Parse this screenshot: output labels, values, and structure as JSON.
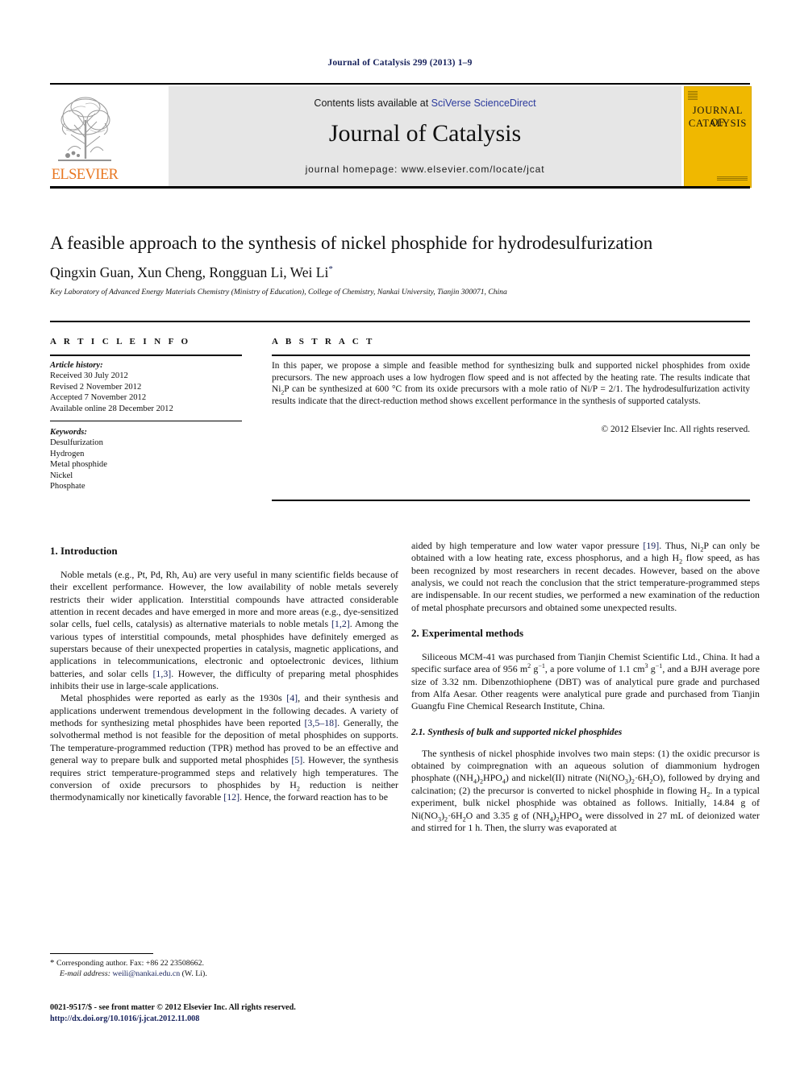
{
  "running_head": "Journal of Catalysis 299 (2013) 1–9",
  "masthead": {
    "contents_prefix": "Contents lists available at ",
    "contents_link": "SciVerse ScienceDirect",
    "journal_title": "Journal of Catalysis",
    "homepage": "journal homepage: www.elsevier.com/locate/jcat",
    "publisher": "ELSEVIER",
    "cover_line1": "JOURNAL OF",
    "cover_line2": "CATALYSIS",
    "cover_color": "#f0b800",
    "publisher_color": "#e87722",
    "link_color": "#2b3a9c"
  },
  "article": {
    "title": "A feasible approach to the synthesis of nickel phosphide for hydrodesulfurization",
    "authors": "Qingxin Guan, Xun Cheng, Rongguan Li, Wei Li",
    "author_marker": "*",
    "affiliation": "Key Laboratory of Advanced Energy Materials Chemistry (Ministry of Education), College of Chemistry, Nankai University, Tianjin 300071, China"
  },
  "info": {
    "heading": "A R T I C L E   I N F O",
    "history_label": "Article history:",
    "history": [
      "Received 30 July 2012",
      "Revised 2 November 2012",
      "Accepted 7 November 2012",
      "Available online 28 December 2012"
    ],
    "keywords_label": "Keywords:",
    "keywords": [
      "Desulfurization",
      "Hydrogen",
      "Metal phosphide",
      "Nickel",
      "Phosphate"
    ]
  },
  "abstract": {
    "heading": "A B S T R A C T",
    "copyright": "© 2012 Elsevier Inc. All rights reserved."
  },
  "sections": {
    "intro_heading": "1. Introduction",
    "experimental_heading": "2. Experimental methods",
    "synthesis_heading": "2.1. Synthesis of bulk and supported nickel phosphides"
  },
  "footnote": {
    "star": "*",
    "corresponding": "Corresponding author. Fax: +86 22 23508662.",
    "email_label": "E-mail address:",
    "email": "weili@nankai.edu.cn",
    "email_owner": "(W. Li)."
  },
  "bottom": {
    "issn_line": "0021-9517/$ - see front matter © 2012 Elsevier Inc. All rights reserved.",
    "doi": "http://dx.doi.org/10.1016/j.jcat.2012.11.008"
  }
}
